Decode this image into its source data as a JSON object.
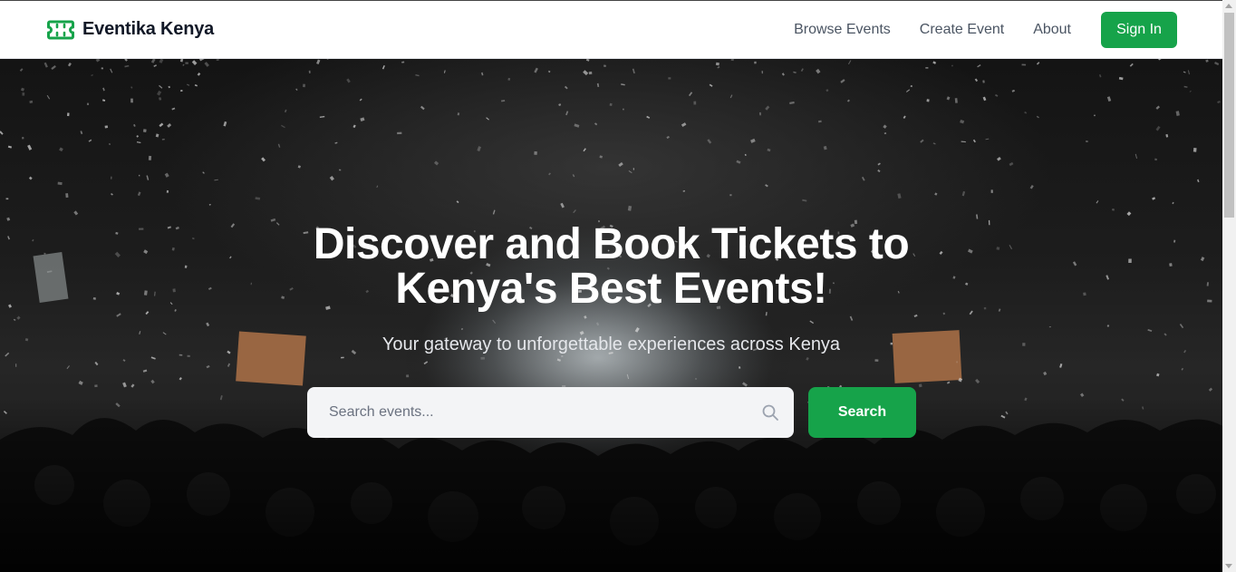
{
  "header": {
    "brand_name": "Eventika Kenya",
    "brand_icon": "ticket-icon",
    "nav": [
      {
        "label": "Browse Events"
      },
      {
        "label": "Create Event"
      },
      {
        "label": "About"
      }
    ],
    "signin_label": "Sign In"
  },
  "hero": {
    "title_line1": "Discover and Book Tickets to",
    "title_line2": "Kenya's Best Events!",
    "subtitle": "Your gateway to unforgettable experiences across Kenya",
    "search": {
      "placeholder": "Search events...",
      "icon": "search-icon",
      "button_label": "Search"
    }
  },
  "colors": {
    "accent": "#16a34a",
    "header_bg": "#ffffff",
    "hero_text": "#ffffff"
  }
}
